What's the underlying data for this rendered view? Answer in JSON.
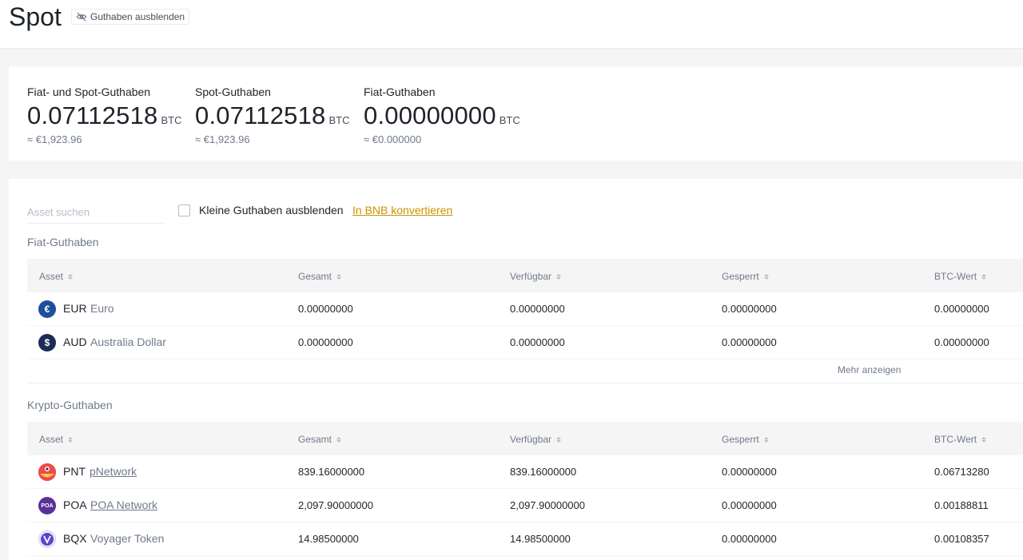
{
  "header": {
    "title": "Spot",
    "hide_balance_label": "Guthaben ausblenden"
  },
  "summary": [
    {
      "label": "Fiat- und Spot-Guthaben",
      "value": "0.07112518",
      "unit": "BTC",
      "fiat": "≈ €1,923.96"
    },
    {
      "label": "Spot-Guthaben",
      "value": "0.07112518",
      "unit": "BTC",
      "fiat": "≈ €1,923.96"
    },
    {
      "label": "Fiat-Guthaben",
      "value": "0.00000000",
      "unit": "BTC",
      "fiat": "≈ €0.000000"
    }
  ],
  "toolbar": {
    "search_placeholder": "Asset suchen",
    "hide_small_label": "Kleine Guthaben ausblenden",
    "convert_bnb_label": "In BNB konvertieren"
  },
  "fiat_section": {
    "title": "Fiat-Guthaben",
    "columns": [
      "Asset",
      "Gesamt",
      "Verfügbar",
      "Gesperrt",
      "BTC-Wert"
    ],
    "rows": [
      {
        "symbol": "EUR",
        "name": "Euro",
        "icon": "euro-icon",
        "total": "0.00000000",
        "available": "0.00000000",
        "locked": "0.00000000",
        "btc": "0.00000000"
      },
      {
        "symbol": "AUD",
        "name": "Australia Dollar",
        "icon": "dollar-icon",
        "total": "0.00000000",
        "available": "0.00000000",
        "locked": "0.00000000",
        "btc": "0.00000000"
      }
    ],
    "more_label": "Mehr anzeigen"
  },
  "crypto_section": {
    "title": "Krypto-Guthaben",
    "columns": [
      "Asset",
      "Gesamt",
      "Verfügbar",
      "Gesperrt",
      "BTC-Wert"
    ],
    "rows": [
      {
        "symbol": "PNT",
        "name": "pNetwork",
        "icon": "pnetwork-icon",
        "total": "839.16000000",
        "available": "839.16000000",
        "locked": "0.00000000",
        "btc": "0.06713280"
      },
      {
        "symbol": "POA",
        "name": "POA Network",
        "icon": "poa-icon",
        "total": "2,097.90000000",
        "available": "2,097.90000000",
        "locked": "0.00000000",
        "btc": "0.00188811"
      },
      {
        "symbol": "BQX",
        "name": "Voyager Token",
        "icon": "voyager-icon",
        "total": "14.98500000",
        "available": "14.98500000",
        "locked": "0.00000000",
        "btc": "0.00108357"
      }
    ]
  },
  "colors": {
    "accent": "#c99400",
    "euro": "#1d4f9c",
    "dollar": "#1a2d55",
    "pnetwork": "#f04a4a",
    "poa": "#5b3199",
    "voyager": "#5b46c8"
  }
}
